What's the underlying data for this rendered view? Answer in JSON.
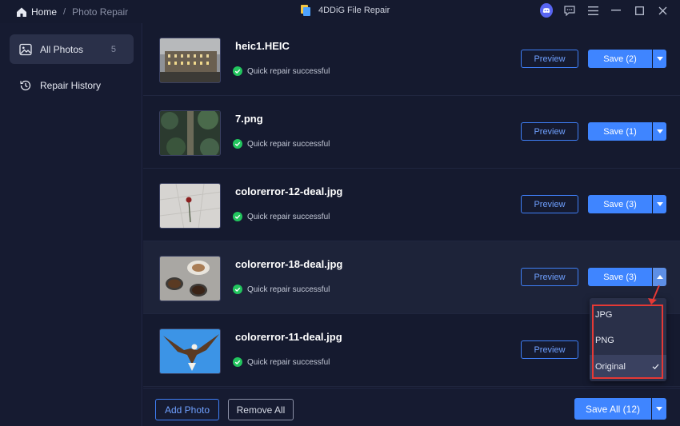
{
  "breadcrumb": {
    "home": "Home",
    "separator": "/",
    "current": "Photo Repair"
  },
  "app": {
    "title": "4DDiG File Repair"
  },
  "sidebar": {
    "items": [
      {
        "label": "All Photos",
        "count": "5",
        "icon": "image-icon",
        "active": true
      },
      {
        "label": "Repair History",
        "icon": "history-icon",
        "active": false
      }
    ]
  },
  "files": [
    {
      "name": "heic1.HEIC",
      "status": "Quick repair successful",
      "preview": "Preview",
      "save": "Save (2)"
    },
    {
      "name": "7.png",
      "status": "Quick repair successful",
      "preview": "Preview",
      "save": "Save (1)"
    },
    {
      "name": "colorerror-12-deal.jpg",
      "status": "Quick repair successful",
      "preview": "Preview",
      "save": "Save (3)"
    },
    {
      "name": "colorerror-18-deal.jpg",
      "status": "Quick repair successful",
      "preview": "Preview",
      "save": "Save (3)"
    },
    {
      "name": "colorerror-11-deal.jpg",
      "status": "Quick repair successful",
      "preview": "Preview",
      "save": "Save (3)"
    }
  ],
  "dropdown": {
    "options": [
      "JPG",
      "PNG",
      "Original"
    ],
    "selected": "Original"
  },
  "footer": {
    "add_photo": "Add Photo",
    "remove_all": "Remove All",
    "save_all": "Save All (12)"
  },
  "colors": {
    "accent": "#3f85ff",
    "success": "#22c55e",
    "highlight": "#e53935"
  }
}
